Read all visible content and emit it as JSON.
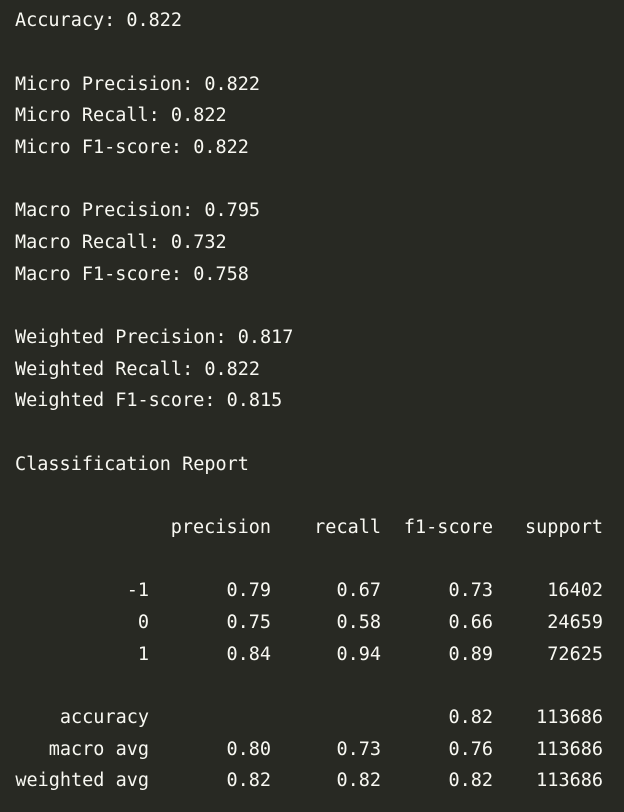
{
  "summary": {
    "accuracy": "Accuracy: 0.822",
    "micro_precision": "Micro Precision: 0.822",
    "micro_recall": "Micro Recall: 0.822",
    "micro_f1": "Micro F1-score: 0.822",
    "macro_precision": "Macro Precision: 0.795",
    "macro_recall": "Macro Recall: 0.732",
    "macro_f1": "Macro F1-score: 0.758",
    "weighted_precision": "Weighted Precision: 0.817",
    "weighted_recall": "Weighted Recall: 0.822",
    "weighted_f1": "Weighted F1-score: 0.815"
  },
  "report": {
    "title": "Classification Report",
    "headers": [
      "precision",
      "recall",
      "f1-score",
      "support"
    ],
    "class_rows": [
      {
        "label": "-1",
        "precision": "0.79",
        "recall": "0.67",
        "f1": "0.73",
        "support": "16402"
      },
      {
        "label": "0",
        "precision": "0.75",
        "recall": "0.58",
        "f1": "0.66",
        "support": "24659"
      },
      {
        "label": "1",
        "precision": "0.84",
        "recall": "0.94",
        "f1": "0.89",
        "support": "72625"
      }
    ],
    "accuracy_row": {
      "label": "accuracy",
      "precision": "",
      "recall": "",
      "f1": "0.82",
      "support": "113686"
    },
    "macro_row": {
      "label": "macro avg",
      "precision": "0.80",
      "recall": "0.73",
      "f1": "0.76",
      "support": "113686"
    },
    "weighted_row": {
      "label": "weighted avg",
      "precision": "0.82",
      "recall": "0.82",
      "f1": "0.82",
      "support": "113686"
    }
  },
  "colors": {
    "background": "#282923",
    "text": "#f8f8f2"
  }
}
